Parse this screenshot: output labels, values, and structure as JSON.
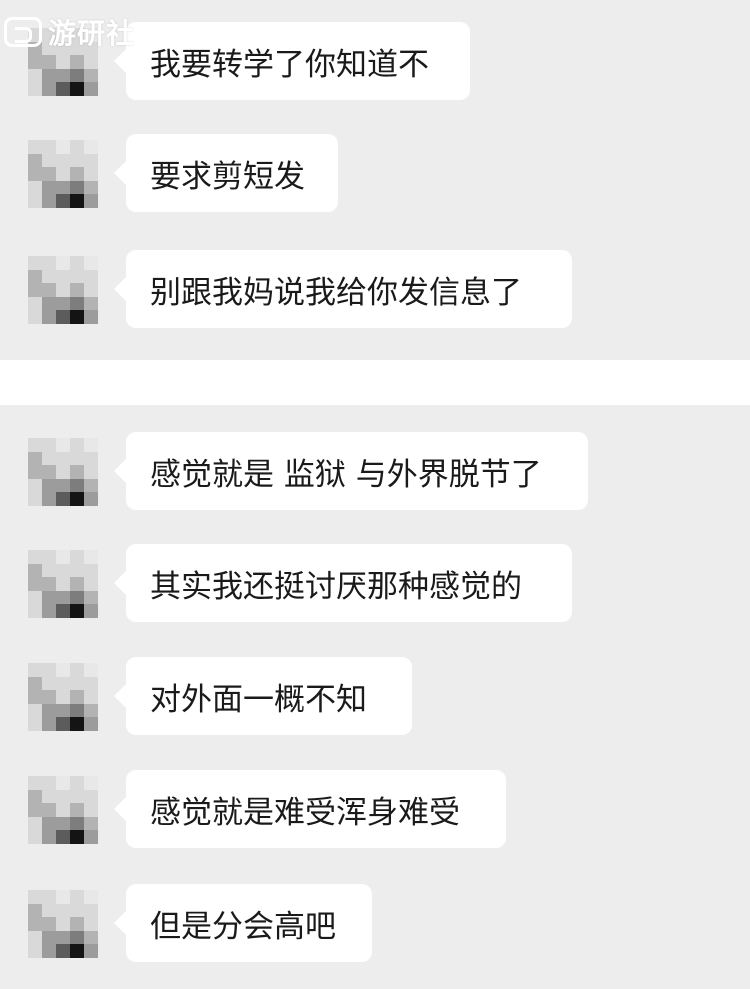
{
  "watermark": {
    "text": "游研社"
  },
  "messages": [
    {
      "text": "我要转学了你知道不"
    },
    {
      "text": "要求剪短发"
    },
    {
      "text": "别跟我妈说我给你发信息了"
    },
    {
      "text": "感觉就是 监狱 与外界脱节了"
    },
    {
      "text": "其实我还挺讨厌那种感觉的"
    },
    {
      "text": "对外面一概不知"
    },
    {
      "text": "感觉就是难受浑身难受"
    },
    {
      "text": "但是分会高吧"
    }
  ]
}
